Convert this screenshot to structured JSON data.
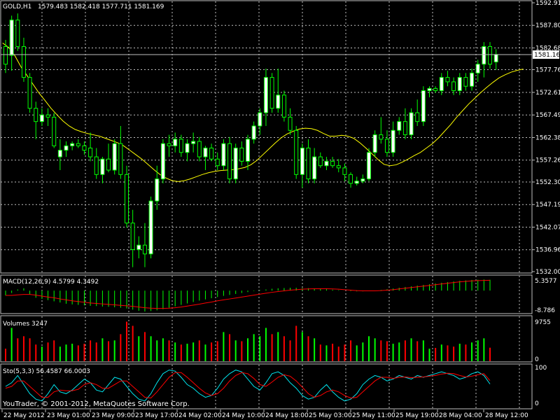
{
  "header": {
    "symbol_label": "GOLD,H1",
    "ohlc": "1579.483 1582.418 1577.711 1581.169"
  },
  "main_axis": {
    "ticks": [
      "1592.910",
      "1587.800",
      "1582.685",
      "1577.765",
      "1572.610",
      "1567.495",
      "1562.380",
      "1557.265",
      "1552.305",
      "1547.190",
      "1542.075",
      "1536.960",
      "1532.000"
    ],
    "tick_values": [
      1592.91,
      1587.8,
      1582.685,
      1577.765,
      1572.61,
      1567.495,
      1562.38,
      1557.265,
      1552.305,
      1547.19,
      1542.075,
      1536.96,
      1532.0
    ],
    "current_price": "1581.169",
    "current_price_value": 1581.169
  },
  "macd": {
    "label": "MACD(12,26,9) 4.5799 4.3492",
    "top_tick": "5.3577",
    "bottom_tick": "-8.786"
  },
  "volumes": {
    "label": "Volumes 3247",
    "top_tick": "9755",
    "bottom_tick": "0"
  },
  "stochastic": {
    "label": "Sto(5,3,3) 56.4587 66.0003",
    "top_tick": "100",
    "bottom_tick": "0"
  },
  "copyright": "YouTrader, © 2001-2012, MetaQuotes Software Corp.",
  "time_axis": [
    "22 May 2012",
    "23 May 01:00",
    "23 May 09:00",
    "23 May 17:00",
    "24 May 02:00",
    "24 May 10:00",
    "24 May 18:00",
    "25 May 03:00",
    "25 May 11:00",
    "25 May 19:00",
    "28 May 04:00",
    "28 May 12:00"
  ],
  "colors": {
    "background": "#000000",
    "grid": "#c0c0c0",
    "bull_candle": "#ffffff",
    "bear_candle": "#000000",
    "wick": "#00ff00",
    "moving_average": "#ffff00",
    "macd_histogram": "#00ff00",
    "macd_signal": "#ff0000",
    "volume_up": "#00ff00",
    "volume_down": "#ff0000",
    "stoch_main": "#00e5ee",
    "stoch_signal": "#ff0000"
  },
  "chart_data": [
    {
      "type": "candlestick",
      "title": "GOLD,H1",
      "ylim": [
        1532.0,
        1592.91
      ],
      "ma_values": [
        1583.8,
        1582.8,
        1581,
        1578.5,
        1576.5,
        1574.5,
        1572.5,
        1570.8,
        1569,
        1567.5,
        1566.1,
        1565,
        1564.2,
        1563.7,
        1563.3,
        1563,
        1562.7,
        1562.2,
        1561.7,
        1561.2,
        1560.5,
        1559.5,
        1558.5,
        1557.5,
        1556.3,
        1555.1,
        1554,
        1553.2,
        1552.6,
        1552.4,
        1552.6,
        1553,
        1553.5,
        1554,
        1554.4,
        1554.7,
        1554.9,
        1555,
        1555.1,
        1555.3,
        1555.6,
        1556.2,
        1557.2,
        1558.5,
        1559.8,
        1561.1,
        1562.3,
        1563.2,
        1563.8,
        1564.3,
        1564.5,
        1564.4,
        1564,
        1563.3,
        1562.7,
        1562.7,
        1562.9,
        1562.7,
        1562.2,
        1561.2,
        1560,
        1558.7,
        1557.4,
        1556.3,
        1556,
        1556.2,
        1556.8,
        1557.5,
        1558.3,
        1559,
        1560,
        1561,
        1562.3,
        1563.8,
        1565.3,
        1567,
        1568.5,
        1570,
        1571.3,
        1572.6,
        1573.8,
        1574.9,
        1575.9,
        1576.6,
        1577.2,
        1577.6,
        1577.9
      ],
      "candles": [
        {
          "o": 1583,
          "h": 1584.5,
          "l": 1577,
          "c": 1579
        },
        {
          "o": 1581,
          "h": 1590,
          "l": 1577.5,
          "c": 1589
        },
        {
          "o": 1589,
          "h": 1590.5,
          "l": 1582,
          "c": 1583
        },
        {
          "o": 1583,
          "h": 1585,
          "l": 1575,
          "c": 1576
        },
        {
          "o": 1576,
          "h": 1577,
          "l": 1568,
          "c": 1569
        },
        {
          "o": 1569,
          "h": 1570.5,
          "l": 1562,
          "c": 1566
        },
        {
          "o": 1566,
          "h": 1569,
          "l": 1565,
          "c": 1567.5
        },
        {
          "o": 1567.5,
          "h": 1569,
          "l": 1565,
          "c": 1567
        },
        {
          "o": 1567,
          "h": 1568,
          "l": 1560,
          "c": 1560.5
        },
        {
          "o": 1558,
          "h": 1562,
          "l": 1555,
          "c": 1559.5
        },
        {
          "o": 1559.5,
          "h": 1561.5,
          "l": 1558,
          "c": 1560.5
        },
        {
          "o": 1560.5,
          "h": 1561.5,
          "l": 1559.5,
          "c": 1561
        },
        {
          "o": 1561,
          "h": 1562,
          "l": 1560,
          "c": 1560.5
        },
        {
          "o": 1560.5,
          "h": 1561.5,
          "l": 1558.5,
          "c": 1559.5
        },
        {
          "o": 1560,
          "h": 1563.5,
          "l": 1557,
          "c": 1558
        },
        {
          "o": 1558,
          "h": 1560,
          "l": 1553,
          "c": 1554
        },
        {
          "o": 1554,
          "h": 1558,
          "l": 1552,
          "c": 1557.5
        },
        {
          "o": 1557.5,
          "h": 1561,
          "l": 1554.5,
          "c": 1555
        },
        {
          "o": 1555,
          "h": 1562,
          "l": 1554,
          "c": 1561
        },
        {
          "o": 1561,
          "h": 1565,
          "l": 1553,
          "c": 1554
        },
        {
          "o": 1554,
          "h": 1556,
          "l": 1542,
          "c": 1543
        },
        {
          "o": 1543,
          "h": 1546,
          "l": 1533,
          "c": 1537
        },
        {
          "o": 1537,
          "h": 1540,
          "l": 1535,
          "c": 1538
        },
        {
          "o": 1538,
          "h": 1543,
          "l": 1533,
          "c": 1536
        },
        {
          "o": 1536,
          "h": 1549,
          "l": 1535,
          "c": 1548
        },
        {
          "o": 1548,
          "h": 1556,
          "l": 1546,
          "c": 1553
        },
        {
          "o": 1553,
          "h": 1562,
          "l": 1552,
          "c": 1561
        },
        {
          "o": 1561,
          "h": 1563,
          "l": 1558,
          "c": 1560.5
        },
        {
          "o": 1560.5,
          "h": 1563.5,
          "l": 1559,
          "c": 1562
        },
        {
          "o": 1562,
          "h": 1563,
          "l": 1558,
          "c": 1559
        },
        {
          "o": 1559,
          "h": 1562,
          "l": 1557,
          "c": 1561
        },
        {
          "o": 1561,
          "h": 1563.5,
          "l": 1559,
          "c": 1561.5
        },
        {
          "o": 1561.5,
          "h": 1562.5,
          "l": 1557,
          "c": 1558
        },
        {
          "o": 1558,
          "h": 1560.5,
          "l": 1555,
          "c": 1560
        },
        {
          "o": 1560,
          "h": 1561,
          "l": 1557,
          "c": 1557.5
        },
        {
          "o": 1557.5,
          "h": 1559,
          "l": 1555,
          "c": 1556
        },
        {
          "o": 1556,
          "h": 1562,
          "l": 1555,
          "c": 1561
        },
        {
          "o": 1561,
          "h": 1562.5,
          "l": 1552,
          "c": 1553
        },
        {
          "o": 1553,
          "h": 1561,
          "l": 1552,
          "c": 1560
        },
        {
          "o": 1560,
          "h": 1561.5,
          "l": 1556,
          "c": 1557
        },
        {
          "o": 1557,
          "h": 1563,
          "l": 1555,
          "c": 1562
        },
        {
          "o": 1562,
          "h": 1566,
          "l": 1561,
          "c": 1565
        },
        {
          "o": 1565,
          "h": 1569,
          "l": 1563,
          "c": 1568
        },
        {
          "o": 1568,
          "h": 1578,
          "l": 1565,
          "c": 1576
        },
        {
          "o": 1576,
          "h": 1577,
          "l": 1568,
          "c": 1569
        },
        {
          "o": 1569,
          "h": 1578,
          "l": 1568,
          "c": 1572
        },
        {
          "o": 1572,
          "h": 1573,
          "l": 1566,
          "c": 1567
        },
        {
          "o": 1567,
          "h": 1569,
          "l": 1563,
          "c": 1564
        },
        {
          "o": 1564,
          "h": 1565,
          "l": 1553,
          "c": 1554
        },
        {
          "o": 1554,
          "h": 1561,
          "l": 1551,
          "c": 1560
        },
        {
          "o": 1560,
          "h": 1562,
          "l": 1552,
          "c": 1553
        },
        {
          "o": 1553,
          "h": 1560,
          "l": 1552,
          "c": 1558
        },
        {
          "o": 1558,
          "h": 1559,
          "l": 1555.5,
          "c": 1556
        },
        {
          "o": 1556,
          "h": 1558,
          "l": 1555,
          "c": 1557
        },
        {
          "o": 1557,
          "h": 1558,
          "l": 1555.5,
          "c": 1556
        },
        {
          "o": 1556,
          "h": 1557.5,
          "l": 1554.5,
          "c": 1555.5
        },
        {
          "o": 1555.5,
          "h": 1556.5,
          "l": 1552.5,
          "c": 1554
        },
        {
          "o": 1554,
          "h": 1554.5,
          "l": 1551,
          "c": 1552
        },
        {
          "o": 1552,
          "h": 1553.5,
          "l": 1551.5,
          "c": 1552.5
        },
        {
          "o": 1552.5,
          "h": 1554,
          "l": 1552,
          "c": 1553
        },
        {
          "o": 1553,
          "h": 1560,
          "l": 1552.5,
          "c": 1559
        },
        {
          "o": 1559,
          "h": 1564,
          "l": 1558,
          "c": 1563
        },
        {
          "o": 1563,
          "h": 1567,
          "l": 1561,
          "c": 1562
        },
        {
          "o": 1562,
          "h": 1564,
          "l": 1558,
          "c": 1559
        },
        {
          "o": 1559,
          "h": 1566,
          "l": 1558,
          "c": 1564
        },
        {
          "o": 1564,
          "h": 1567,
          "l": 1563,
          "c": 1566
        },
        {
          "o": 1566,
          "h": 1569,
          "l": 1562,
          "c": 1563
        },
        {
          "o": 1563,
          "h": 1569,
          "l": 1562,
          "c": 1568
        },
        {
          "o": 1568,
          "h": 1571,
          "l": 1565,
          "c": 1566
        },
        {
          "o": 1566,
          "h": 1574,
          "l": 1565,
          "c": 1573
        },
        {
          "o": 1573,
          "h": 1574,
          "l": 1571.5,
          "c": 1573.5
        },
        {
          "o": 1573.5,
          "h": 1574,
          "l": 1572.5,
          "c": 1573
        },
        {
          "o": 1573,
          "h": 1577,
          "l": 1572,
          "c": 1576
        },
        {
          "o": 1576,
          "h": 1577.5,
          "l": 1574,
          "c": 1575
        },
        {
          "o": 1575,
          "h": 1576,
          "l": 1572,
          "c": 1573
        },
        {
          "o": 1573,
          "h": 1577,
          "l": 1572,
          "c": 1576
        },
        {
          "o": 1576,
          "h": 1577,
          "l": 1573,
          "c": 1574
        },
        {
          "o": 1574,
          "h": 1578,
          "l": 1573,
          "c": 1577
        },
        {
          "o": 1577,
          "h": 1580,
          "l": 1575,
          "c": 1579
        },
        {
          "o": 1579,
          "h": 1584,
          "l": 1576,
          "c": 1583
        },
        {
          "o": 1583,
          "h": 1584,
          "l": 1578,
          "c": 1579
        },
        {
          "o": 1579.5,
          "h": 1582.4,
          "l": 1577.7,
          "c": 1581.2
        }
      ]
    },
    {
      "type": "bar",
      "title": "MACD(12,26,9) 4.5799 4.3492",
      "ylim": [
        -8.786,
        5.3577
      ],
      "series": [
        {
          "values": [
            -2,
            -1,
            0.5,
            1,
            -1.5,
            -3,
            -3.5,
            -4,
            -4.5,
            -5,
            -5.5,
            -5.8,
            -6,
            -6.2,
            -6.4,
            -6.5,
            -6.7,
            -6.8,
            -7,
            -7.2,
            -7.5,
            -8,
            -8.5,
            -8.8,
            -8.6,
            -8.3,
            -7.8,
            -7.2,
            -6.6,
            -6,
            -5.4,
            -4.8,
            -4.2,
            -3.7,
            -3.2,
            -2.7,
            -2.2,
            -1.8,
            -1.4,
            -1,
            -0.6,
            -0.2,
            0.2,
            0.5,
            0.8,
            1,
            1.1,
            1.2,
            1.2,
            1.1,
            1,
            0.9,
            0.8,
            0.6,
            0.4,
            0.2,
            0,
            -0.2,
            -0.3,
            -0.3,
            -0.2,
            0,
            0.3,
            0.6,
            0.9,
            1.2,
            1.5,
            1.8,
            2.1,
            2.4,
            2.7,
            3,
            3.3,
            3.6,
            3.9,
            4.1,
            4.3,
            4.5,
            4.6,
            4.7,
            4.58
          ]
        },
        {
          "values": [
            -2,
            -2,
            -1.8,
            -1.6,
            -1.6,
            -1.9,
            -2.3,
            -2.7,
            -3,
            -3.5,
            -3.9,
            -4.3,
            -4.6,
            -4.9,
            -5.2,
            -5.4,
            -5.6,
            -5.8,
            -6,
            -6.2,
            -6.4,
            -6.6,
            -6.9,
            -7.2,
            -7.4,
            -7.5,
            -7.5,
            -7.4,
            -7.2,
            -6.9,
            -6.5,
            -6.1,
            -5.7,
            -5.2,
            -4.8,
            -4.3,
            -3.9,
            -3.5,
            -3.1,
            -2.7,
            -2.3,
            -1.9,
            -1.5,
            -1.1,
            -0.7,
            -0.4,
            -0.1,
            0.2,
            0.4,
            0.6,
            0.7,
            0.8,
            0.8,
            0.8,
            0.7,
            0.6,
            0.4,
            0.2,
            0,
            -0.1,
            -0.1,
            -0.1,
            0,
            0.2,
            0.4,
            0.7,
            1,
            1.3,
            1.6,
            1.9,
            2.2,
            2.5,
            2.8,
            3.1,
            3.4,
            3.7,
            3.9,
            4.1,
            4.2,
            4.3,
            4.35
          ]
        }
      ]
    },
    {
      "type": "bar",
      "title": "Volumes 3247",
      "ylim": [
        0,
        9755
      ],
      "series": [
        {
          "values": [
            3000,
            8000,
            5500,
            6000,
            5500,
            4000,
            3500,
            4500,
            5000,
            3500,
            4000,
            4200,
            3800,
            4200,
            5000,
            4500,
            5500,
            4800,
            5000,
            6500,
            9500,
            8500,
            6000,
            7000,
            6000,
            5000,
            5500,
            5000,
            4500,
            4000,
            4200,
            4500,
            5000,
            4000,
            4500,
            4800,
            7000,
            6500,
            5000,
            4800,
            5500,
            6500,
            6000,
            8000,
            6500,
            7000,
            6000,
            5000,
            8500,
            7000,
            6000,
            5500,
            4000,
            3800,
            4200,
            3500,
            4000,
            5000,
            3800,
            4500,
            6000,
            5500,
            5000,
            4800,
            4200,
            4500,
            5000,
            5500,
            4800,
            5000,
            3000,
            3200,
            4000,
            3800,
            3500,
            4200,
            4000,
            4500,
            5000,
            5500,
            3247
          ]
        }
      ]
    },
    {
      "type": "line",
      "title": "Sto(5,3,3) 56.4587 66.0003",
      "ylim": [
        0,
        100
      ],
      "series": [
        {
          "values": [
            50,
            60,
            80,
            55,
            30,
            15,
            10,
            30,
            55,
            35,
            30,
            40,
            55,
            70,
            60,
            40,
            35,
            55,
            75,
            70,
            50,
            30,
            15,
            10,
            30,
            60,
            85,
            95,
            92,
            75,
            55,
            45,
            30,
            20,
            25,
            45,
            70,
            85,
            95,
            90,
            70,
            50,
            40,
            60,
            85,
            90,
            80,
            60,
            45,
            25,
            15,
            20,
            40,
            55,
            35,
            20,
            10,
            15,
            30,
            55,
            70,
            80,
            75,
            65,
            70,
            80,
            75,
            70,
            80,
            75,
            80,
            85,
            90,
            85,
            80,
            70,
            75,
            85,
            90,
            80,
            56.5
          ]
        },
        {
          "values": [
            45,
            50,
            65,
            65,
            50,
            35,
            20,
            20,
            35,
            40,
            38,
            38,
            42,
            55,
            60,
            55,
            45,
            45,
            55,
            65,
            65,
            50,
            35,
            20,
            18,
            35,
            55,
            75,
            88,
            88,
            75,
            60,
            45,
            32,
            25,
            30,
            45,
            65,
            80,
            88,
            85,
            72,
            55,
            50,
            62,
            75,
            82,
            78,
            65,
            48,
            30,
            20,
            25,
            35,
            40,
            35,
            25,
            18,
            20,
            35,
            50,
            65,
            75,
            75,
            72,
            75,
            76,
            74,
            75,
            76,
            78,
            80,
            84,
            86,
            85,
            80,
            76,
            78,
            82,
            85,
            66
          ]
        }
      ]
    }
  ]
}
